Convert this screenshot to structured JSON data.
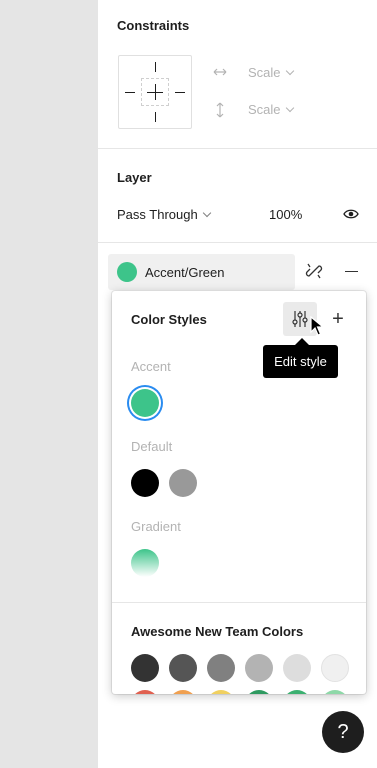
{
  "constraints": {
    "title": "Constraints",
    "horizontal": {
      "icon": "horizontal-arrows-icon",
      "value": "Scale"
    },
    "vertical": {
      "icon": "vertical-arrows-icon",
      "value": "Scale"
    }
  },
  "layer": {
    "title": "Layer",
    "blend_mode": "Pass Through",
    "opacity": "100%",
    "visibility_icon": "eye-icon"
  },
  "fill_style": {
    "name": "Accent/Green",
    "color": "#3dc48a",
    "detach_icon": "detach-link-icon",
    "remove_icon": "minus-icon"
  },
  "color_styles": {
    "title": "Color Styles",
    "edit_icon": "sliders-icon",
    "add_icon": "plus-icon",
    "add_label": "+",
    "tooltip": "Edit style",
    "groups": [
      {
        "label": "Accent",
        "colors": [
          "#3dc48a"
        ]
      },
      {
        "label": "Default",
        "colors": [
          "#000000",
          "#999999"
        ]
      },
      {
        "label": "Gradient",
        "colors": [
          "gradient:#3dc48a-#ffffff"
        ]
      }
    ],
    "team_library": {
      "title": "Awesome New Team Colors",
      "row1": [
        "#333333",
        "#555555",
        "#808080",
        "#b3b3b3",
        "#dddddd",
        "#f0f0f0"
      ],
      "row2": [
        "#e06050",
        "#f0a050",
        "#f0d060",
        "#2e9a60",
        "#3bb070",
        "#8ed8a8"
      ]
    }
  },
  "help": {
    "label": "?"
  }
}
